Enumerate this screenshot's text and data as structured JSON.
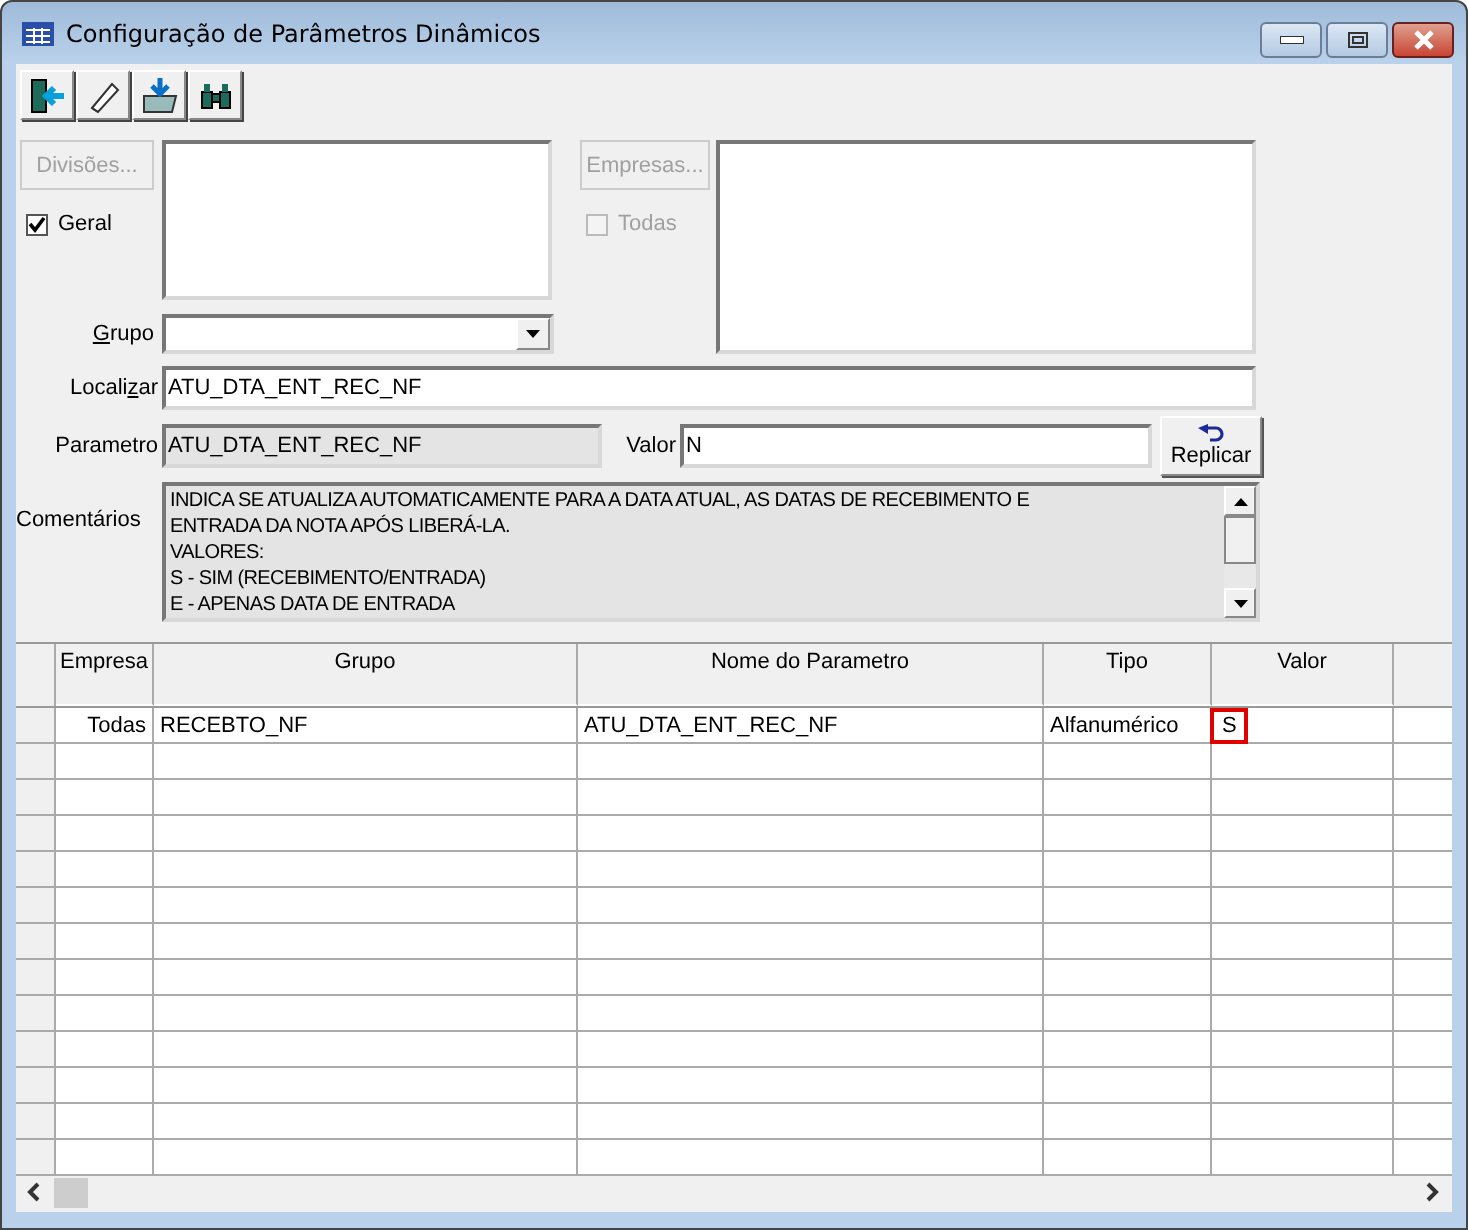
{
  "window": {
    "title": "Configuração de Parâmetros Dinâmicos"
  },
  "toolbar": [
    {
      "kind": "exit"
    },
    {
      "kind": "erase"
    },
    {
      "kind": "import"
    },
    {
      "kind": "find"
    }
  ],
  "divisions": {
    "button": "Divisões...",
    "disabled": true,
    "checkbox": {
      "label": "Geral",
      "checked": true,
      "disabled": false
    }
  },
  "companies": {
    "button": "Empresas...",
    "disabled": true,
    "checkbox": {
      "label": "Todas",
      "checked": false,
      "disabled": true
    }
  },
  "group": {
    "label": {
      "key": "G",
      "after": "rupo"
    }
  },
  "search": {
    "label": {
      "before": "Locali",
      "key": "z",
      "after": "ar"
    },
    "value": "ATU_DTA_ENT_REC_NF"
  },
  "parameter": {
    "label": "Parametro",
    "value": "ATU_DTA_ENT_REC_NF",
    "readonly": true
  },
  "value": {
    "label": "Valor",
    "value": "N"
  },
  "replicate_button": "Replicar",
  "comments": {
    "label": "Comentários",
    "readonly": true,
    "lines": [
      "INDICA SE ATUALIZA AUTOMATICAMENTE PARA A DATA ATUAL, AS DATAS DE RECEBIMENTO E",
      "ENTRADA DA NOTA APÓS LIBERÁ-LA.",
      "VALORES:",
      "S - SIM (RECEBIMENTO/ENTRADA)",
      "E - APENAS DATA DE ENTRADA"
    ]
  },
  "table": {
    "columns": [
      "Empresa",
      "Grupo",
      "Nome do Parametro",
      "Tipo",
      "Valor"
    ],
    "rows": [
      {
        "cells": [
          {
            "text": "Todas",
            "selected": false
          },
          {
            "text": "RECEBTO_NF",
            "selected": false
          },
          {
            "text": "ATU_DTA_ENT_REC_NF",
            "selected": false
          },
          {
            "text": "Alfanumérico",
            "selected": false
          },
          {
            "text": "S",
            "selected": true
          }
        ]
      }
    ]
  }
}
